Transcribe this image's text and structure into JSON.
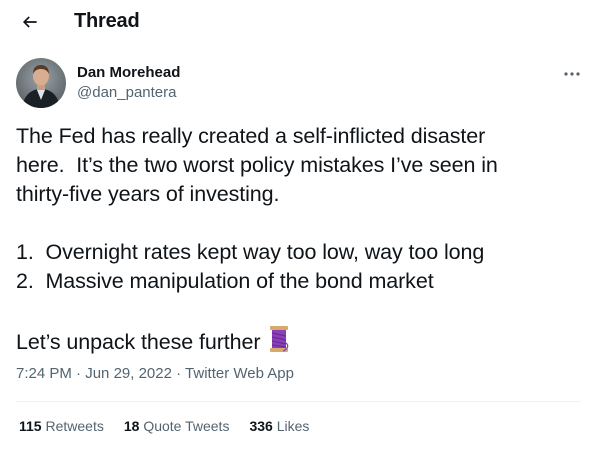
{
  "header": {
    "back_icon": "arrow-left-icon",
    "title": "Thread"
  },
  "author": {
    "display_name": "Dan Morehead",
    "handle": "@dan_pantera",
    "more_icon": "more-horizontal-icon"
  },
  "tweet": {
    "paragraph1": [
      "The Fed has really created a self-inflicted disaster",
      "here.  It’s the two worst policy mistakes I’ve seen in",
      "thirty-five years of investing."
    ],
    "list": [
      "1.  Overnight rates kept way too low, way too long",
      "2.  Massive manipulation of the bond market"
    ],
    "closing": "Let’s unpack these further",
    "closing_emoji": "thread-spool-icon"
  },
  "meta": {
    "time": "7:24 PM",
    "separator": " · ",
    "date": "Jun 29, 2022",
    "source": "Twitter Web App"
  },
  "stats": {
    "retweets_count": "115",
    "retweets_label": "Retweets",
    "quotes_count": "18",
    "quotes_label": "Quote Tweets",
    "likes_count": "336",
    "likes_label": "Likes"
  },
  "colors": {
    "text_primary": "#0f1419",
    "text_secondary": "#536471",
    "divider": "#eff3f4",
    "spool": "#8b3fb8"
  }
}
